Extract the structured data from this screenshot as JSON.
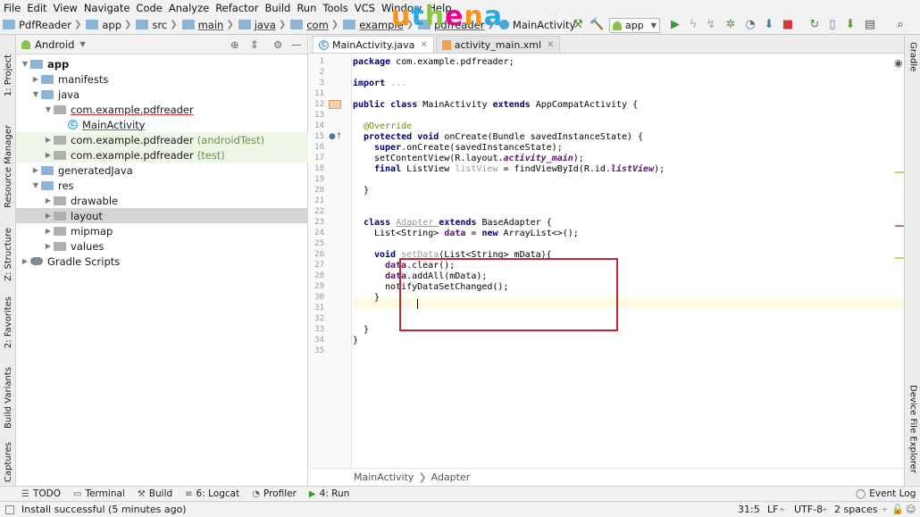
{
  "menu": [
    "File",
    "Edit",
    "View",
    "Navigate",
    "Code",
    "Analyze",
    "Refactor",
    "Build",
    "Run",
    "Tools",
    "VCS",
    "Window",
    "Help"
  ],
  "breadcrumbs": [
    "PdfReader",
    "app",
    "src",
    "main",
    "java",
    "com",
    "example",
    "pdfreader",
    "MainActivity"
  ],
  "logo": {
    "u": "u",
    "t": "t",
    "h": "h",
    "e": "e",
    "n": "n",
    "a": "a"
  },
  "run_config": "app",
  "left_tabs": [
    "1: Project",
    "Resource Manager",
    "Z: Structure",
    "2: Favorites",
    "Build Variants",
    "Captures"
  ],
  "right_tabs": [
    "Gradle",
    "Device File Explorer"
  ],
  "project": {
    "view": "Android",
    "tree": [
      {
        "label": "app",
        "extra": ""
      },
      {
        "label": "manifests",
        "extra": ""
      },
      {
        "label": "java",
        "extra": ""
      },
      {
        "label": "com.example.pdfreader",
        "extra": ""
      },
      {
        "label": "MainActivity",
        "extra": ""
      },
      {
        "label": "com.example.pdfreader",
        "extra": "(androidTest)"
      },
      {
        "label": "com.example.pdfreader",
        "extra": "(test)"
      },
      {
        "label": "generatedJava",
        "extra": ""
      },
      {
        "label": "res",
        "extra": ""
      },
      {
        "label": "drawable",
        "extra": ""
      },
      {
        "label": "layout",
        "extra": ""
      },
      {
        "label": "mipmap",
        "extra": ""
      },
      {
        "label": "values",
        "extra": ""
      },
      {
        "label": "Gradle Scripts",
        "extra": ""
      }
    ]
  },
  "tabs": [
    "MainActivity.java",
    "activity_main.xml"
  ],
  "line_numbers": [
    "1",
    "2",
    "3",
    "11",
    "12",
    "13",
    "14",
    "15",
    "16",
    "17",
    "18",
    "19",
    "20",
    "21",
    "22",
    "23",
    "24",
    "25",
    "26",
    "27",
    "28",
    "29",
    "30",
    "31",
    "32",
    "33",
    "34",
    "35"
  ],
  "code": {
    "l1a": "package ",
    "l1b": "com.example.pdfreader;",
    "l3a": "import ",
    "l3b": "...",
    "l12a": "public class ",
    "l12b": "MainActivity ",
    "l12c": "extends ",
    "l12d": "AppCompatActivity {",
    "l14": "@Override",
    "l15a": "protected void ",
    "l15b": "onCreate(Bundle savedInstanceState) {",
    "l16a": "super",
    ".": ".",
    "l16b": ".onCreate(savedInstanceState);",
    "l17a": "setContentView(R.layout.",
    "l17b": "activity_main",
    "l17c": ");",
    "l18a": "final ",
    "l18b": "ListView ",
    "l18c": "listView",
    "l18d": " = findViewById(R.id.",
    "l18e": "listView",
    "l18f": ");",
    "l20": "}",
    "l23a": "class ",
    "l23b": "Adapter ",
    "l23c": "extends ",
    "l23d": "BaseAdapter {",
    "l24a": "List<String> ",
    "l24b": "data",
    "l24c": " = ",
    "l24d": "new ",
    "l24e": "ArrayList<>();",
    "l26a": "void ",
    "l26b": "setData",
    "l26c": "(List<String> mData){",
    "l27a": "data",
    ".27": ".clear();",
    "l28a": "data",
    ".28": ".addAll(mData);",
    "l29": "notifyDataSetChanged();",
    "l30": "}",
    "l33": "}",
    "l34": "}"
  },
  "editor_breadcrumb": [
    "MainActivity",
    "Adapter"
  ],
  "bottom_tools": [
    "TODO",
    "Terminal",
    "Build",
    "6: Logcat",
    "Profiler",
    "4: Run",
    "Event Log"
  ],
  "status": {
    "message": "Install successful (5 minutes ago)",
    "position": "31:5",
    "line_sep": "LF",
    "encoding": "UTF-8",
    "indent": "2 spaces"
  }
}
